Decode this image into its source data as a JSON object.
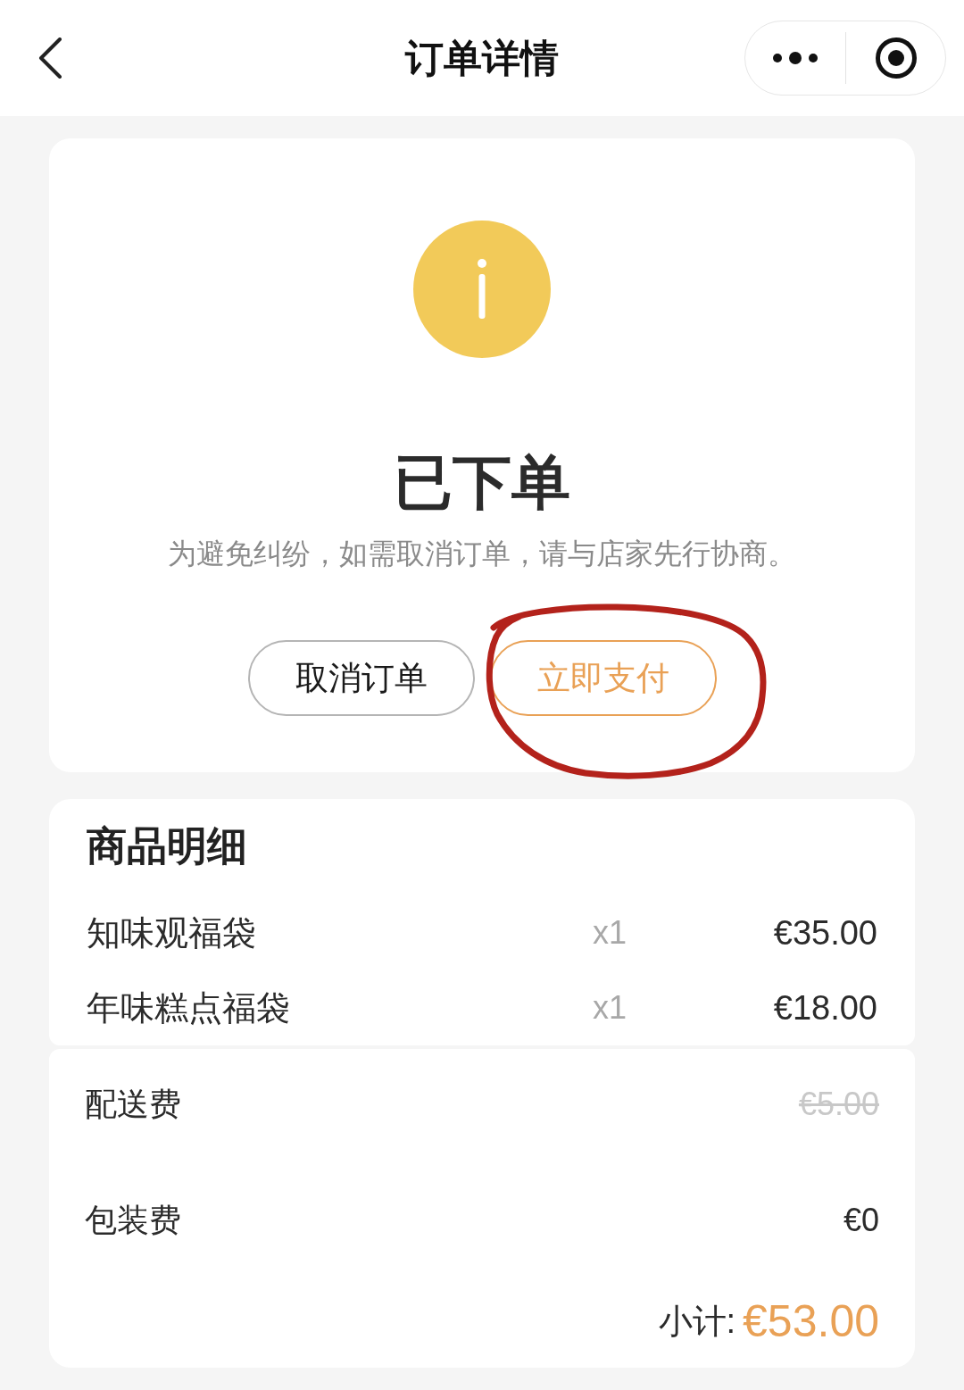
{
  "nav_bar": {
    "title": "订单详情"
  },
  "status": {
    "title": "已下单",
    "message": "为避免纠纷，如需取消订单，请与店家先行协商。",
    "actions": [
      {
        "label": "取消订单",
        "kind": "secondary",
        "annotated": false
      },
      {
        "label": "立即支付",
        "kind": "primary",
        "annotated": true
      }
    ]
  },
  "items": {
    "title": "商品明细",
    "rows": [
      {
        "name": "知味观福袋",
        "quantity": "x1",
        "price": "€35.00"
      },
      {
        "name": "年味糕点福袋",
        "quantity": "x1",
        "price": "€18.00"
      }
    ]
  },
  "fees": [
    {
      "label": "配送费",
      "amount": "€5.00",
      "struck": true
    },
    {
      "label": "包装费",
      "amount": "€0",
      "struck": false
    }
  ],
  "subtotal": {
    "label": "小计:",
    "amount": "€53.00"
  }
}
